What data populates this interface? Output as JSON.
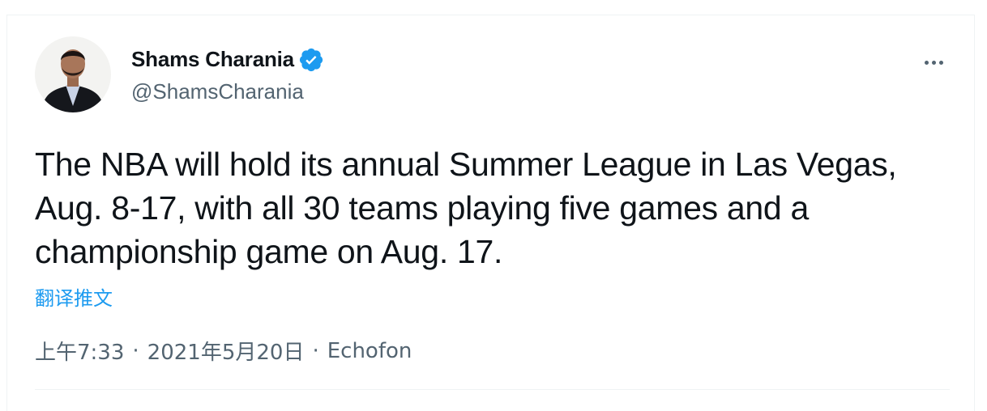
{
  "author": {
    "display_name": "Shams Charania",
    "handle": "@ShamsCharania",
    "verified": true
  },
  "icons": {
    "verified": "verified-badge-icon",
    "more": "more-dots-icon"
  },
  "colors": {
    "accent": "#1d9bf0",
    "text": "#0f1419",
    "secondary": "#536471"
  },
  "tweet": {
    "text": "The NBA will hold its annual Summer League in Las Vegas, Aug. 8-17, with all 30 teams playing five games and a championship game on Aug. 17.",
    "translate_label": "翻译推文",
    "time": "上午7:33",
    "separator": "·",
    "date": "2021年5月20日",
    "source": "Echofon"
  }
}
